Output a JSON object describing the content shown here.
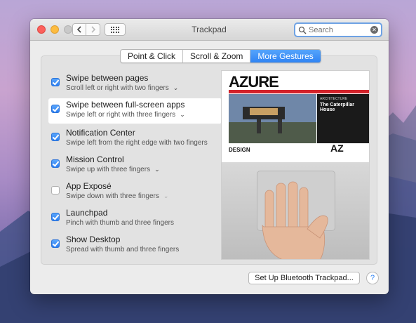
{
  "window": {
    "title": "Trackpad",
    "search_placeholder": "Search"
  },
  "tabs": [
    {
      "label": "Point & Click",
      "active": false
    },
    {
      "label": "Scroll & Zoom",
      "active": false
    },
    {
      "label": "More Gestures",
      "active": true
    }
  ],
  "gestures": [
    {
      "title": "Swipe between pages",
      "subtitle": "Scroll left or right with two fingers",
      "checked": true,
      "selected": false,
      "has_menu": true
    },
    {
      "title": "Swipe between full-screen apps",
      "subtitle": "Swipe left or right with three fingers",
      "checked": true,
      "selected": true,
      "has_menu": true
    },
    {
      "title": "Notification Center",
      "subtitle": "Swipe left from the right edge with two fingers",
      "checked": true,
      "selected": false,
      "has_menu": false
    },
    {
      "title": "Mission Control",
      "subtitle": "Swipe up with three fingers",
      "checked": true,
      "selected": false,
      "has_menu": true
    },
    {
      "title": "App Exposé",
      "subtitle": "Swipe down with three fingers",
      "checked": false,
      "selected": false,
      "has_menu": true
    },
    {
      "title": "Launchpad",
      "subtitle": "Pinch with thumb and three fingers",
      "checked": true,
      "selected": false,
      "has_menu": false
    },
    {
      "title": "Show Desktop",
      "subtitle": "Spread with thumb and three fingers",
      "checked": true,
      "selected": false,
      "has_menu": false
    }
  ],
  "preview": {
    "logo": "AZURE",
    "headline": "The Caterpillar House",
    "section": "DESIGN",
    "badge": "AZ"
  },
  "footer": {
    "setup_button": "Set Up Bluetooth Trackpad...",
    "help_label": "?"
  },
  "colors": {
    "accent": "#2f83f4",
    "close": "#fc605c",
    "minimize": "#fdbc40"
  }
}
